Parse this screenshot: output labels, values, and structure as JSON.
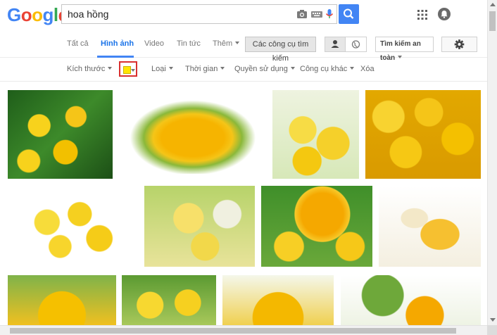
{
  "header": {
    "logo_letters": [
      {
        "ch": "G",
        "color": "#4285f4"
      },
      {
        "ch": "o",
        "color": "#ea4335"
      },
      {
        "ch": "o",
        "color": "#fbbc05"
      },
      {
        "ch": "g",
        "color": "#4285f4"
      },
      {
        "ch": "l",
        "color": "#34a853"
      },
      {
        "ch": "e",
        "color": "#ea4335"
      }
    ],
    "search_value": "hoa hồng",
    "icons": [
      "camera-icon",
      "keyboard-icon",
      "microphone-icon",
      "search-icon",
      "apps-icon",
      "notifications-icon"
    ]
  },
  "nav": {
    "tabs": [
      "Tất cả",
      "Hình ảnh",
      "Video",
      "Tin tức",
      "Thêm"
    ],
    "active_tab": "Hình ảnh",
    "search_tools": "Các công cụ tìm kiếm",
    "safe_search": "Tìm kiếm an toàn"
  },
  "tools": {
    "items": [
      "Kích thước",
      "Loại",
      "Thời gian",
      "Quyền sử dụng",
      "Công cụ khác",
      "Xóa"
    ],
    "selected_color": "#ffe600"
  },
  "results": {
    "count": 13,
    "accent_colors": [
      "#f5c518",
      "#2e7d32",
      "#ffffff"
    ]
  },
  "colors": {
    "accent": "#4285f4",
    "highlight": "#d93030"
  }
}
